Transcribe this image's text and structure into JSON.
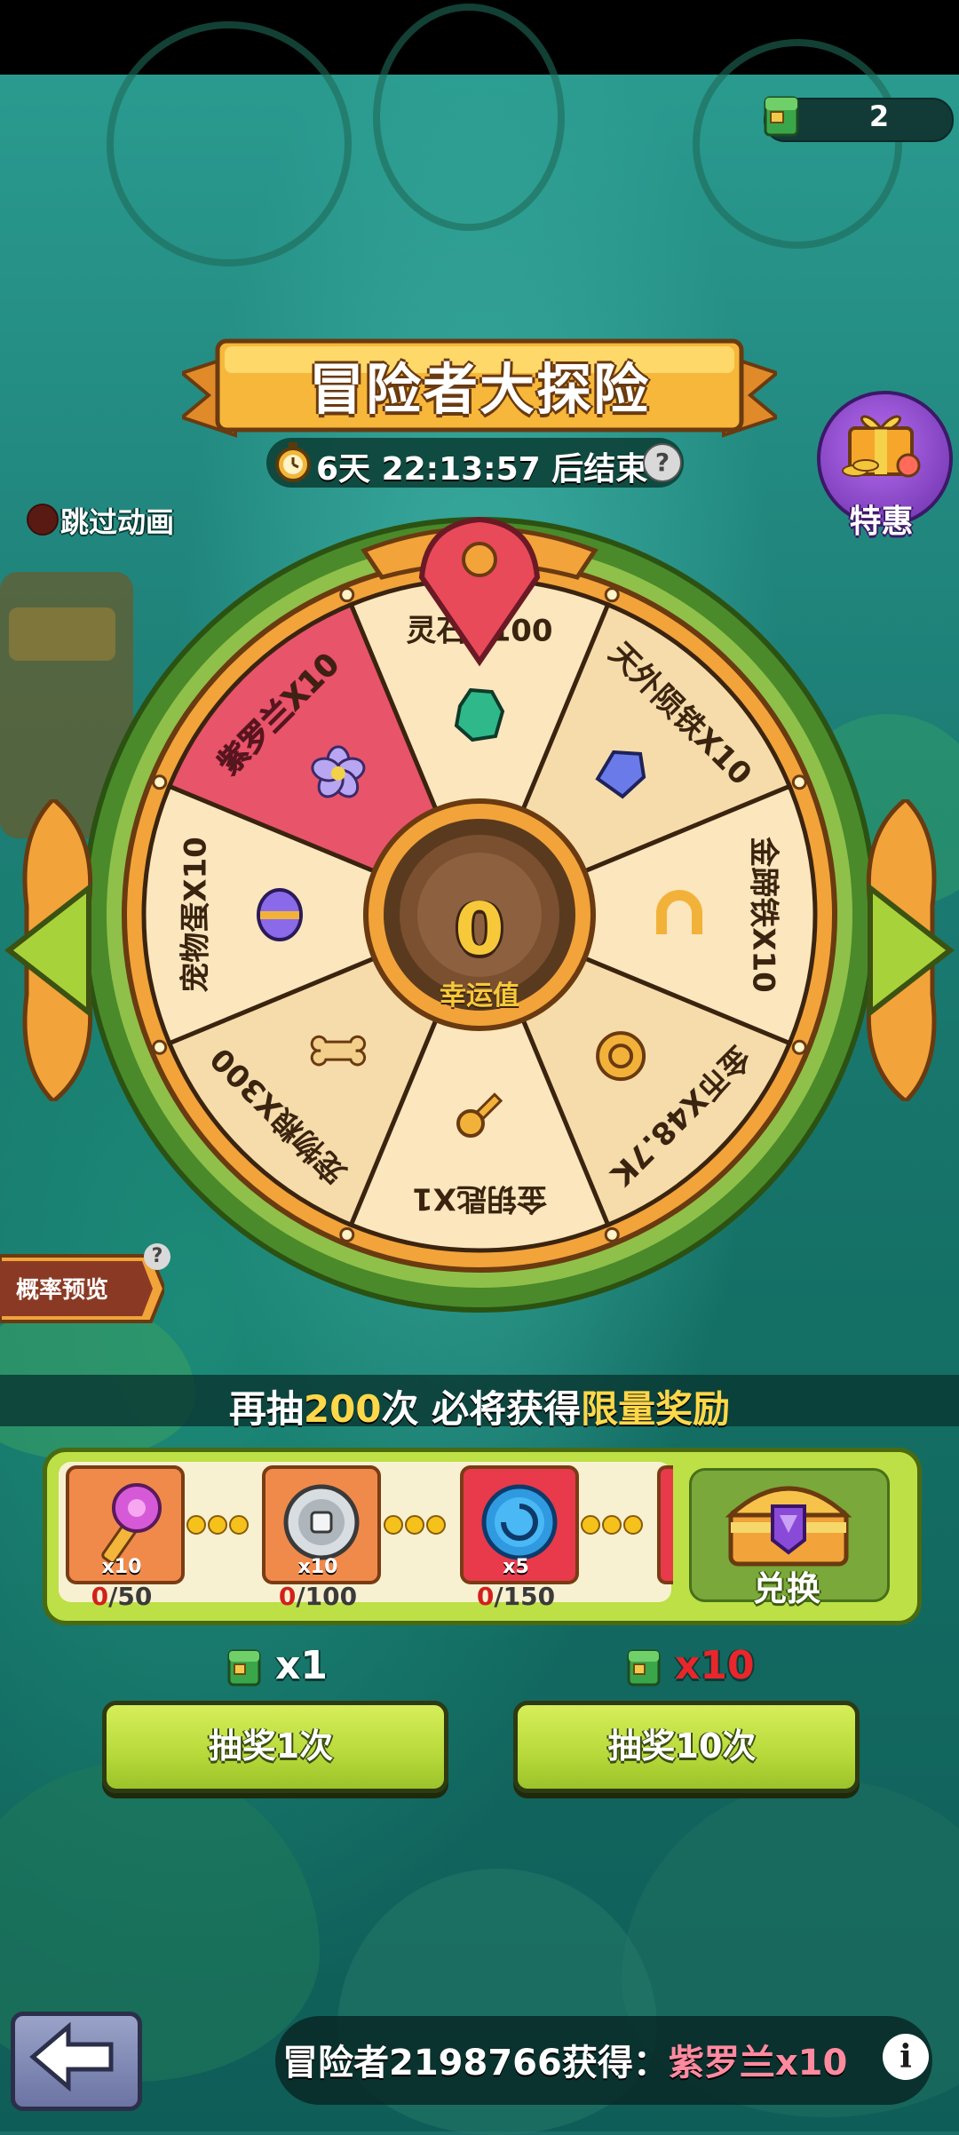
{
  "header": {
    "ticket_count": "2"
  },
  "event": {
    "title": "冒险者大探险",
    "timer": "6天 22:13:57 后结束",
    "help_symbol": "?"
  },
  "special_offer": {
    "label": "特惠"
  },
  "skip_animation": {
    "label": "跳过动画"
  },
  "wheel": {
    "center_value": "0",
    "center_label": "幸运值",
    "segments": [
      {
        "label": "灵石X100",
        "icon": "spirit-stone-icon"
      },
      {
        "label": "天外陨铁X10",
        "icon": "meteorite-iron-icon"
      },
      {
        "label": "金蹄铁X10",
        "icon": "gold-horseshoe-icon"
      },
      {
        "label": "金币X48.7K",
        "icon": "gold-coin-icon"
      },
      {
        "label": "金钥匙X1",
        "icon": "gold-key-icon"
      },
      {
        "label": "宠物粮X300",
        "icon": "pet-bone-icon"
      },
      {
        "label": "宠物蛋X10",
        "icon": "pet-egg-icon"
      },
      {
        "label": "紫罗兰X10",
        "icon": "violet-flower-icon"
      }
    ],
    "highlight_index": 7
  },
  "probability_preview": {
    "label": "概率预览",
    "help_symbol": "?"
  },
  "limit_banner": {
    "prefix": "再抽",
    "count": "200",
    "middle": "次 必将获得",
    "reward": "限量奖励"
  },
  "milestones": [
    {
      "icon": "violet-key-icon",
      "qty": "x10",
      "current": "0",
      "target": "/50"
    },
    {
      "icon": "silver-coin-icon",
      "qty": "x10",
      "current": "0",
      "target": "/100"
    },
    {
      "icon": "blue-gem-icon",
      "qty": "x5",
      "current": "0",
      "target": "/150"
    }
  ],
  "exchange": {
    "label": "兑换"
  },
  "draw_single": {
    "cost": "x1",
    "label": "抽奖1次",
    "cost_color": "#ffffff"
  },
  "draw_ten": {
    "cost": "x10",
    "label": "抽奖10次",
    "cost_color": "#e8262b"
  },
  "announcement": {
    "prefix": "冒险者2198766获得：",
    "reward": "紫罗兰x10"
  },
  "info_symbol": "i"
}
